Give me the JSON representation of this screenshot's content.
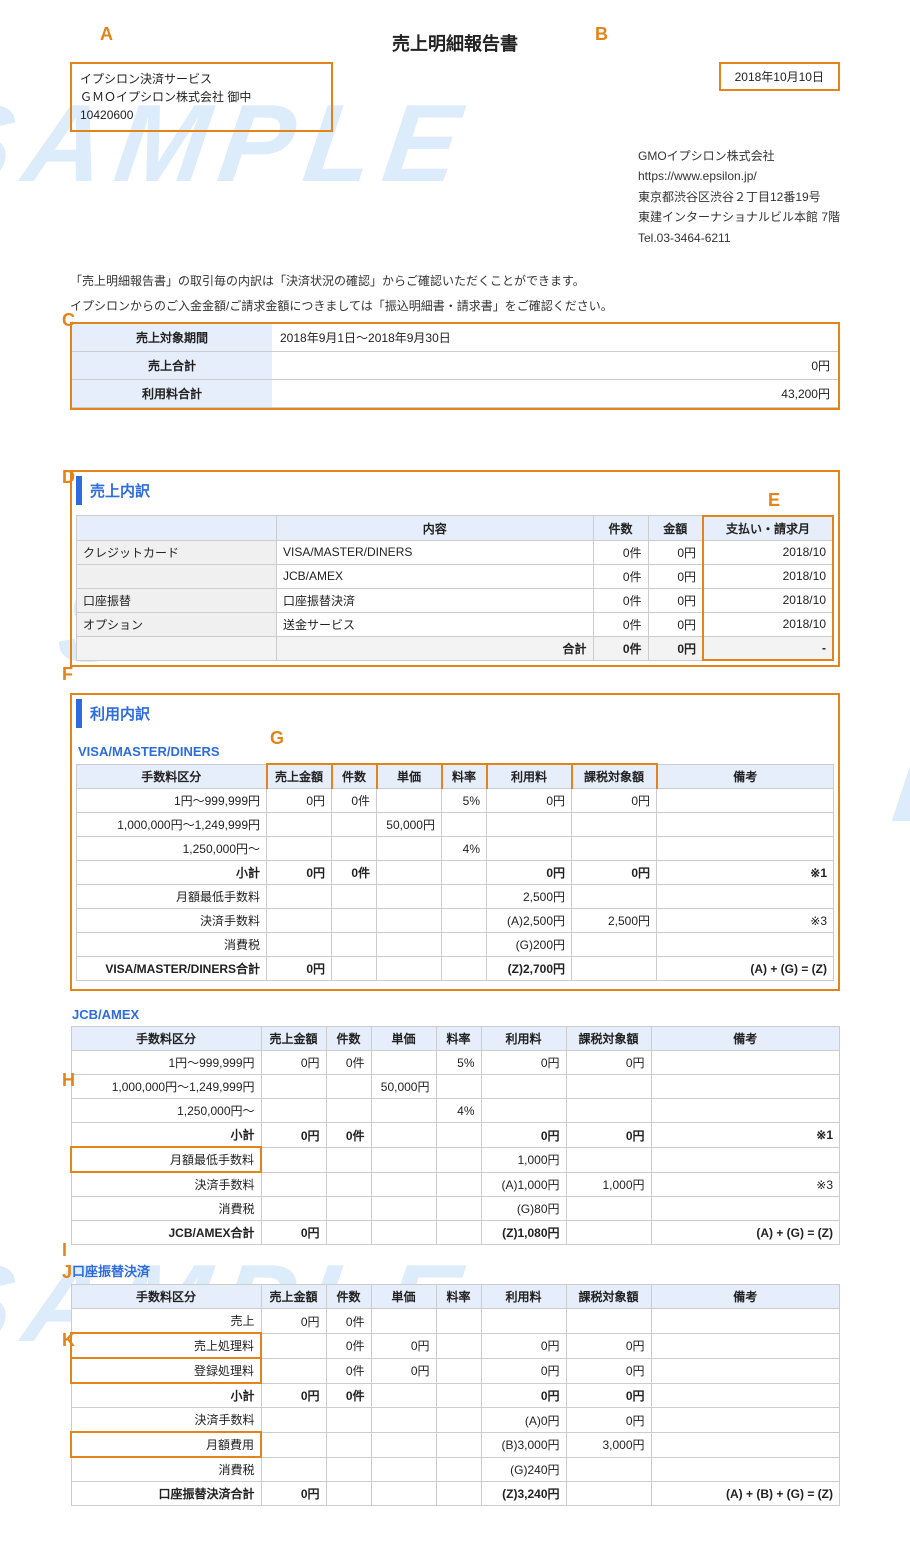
{
  "document": {
    "title": "売上明細報告書",
    "recipient": {
      "line1": "イプシロン決済サービス",
      "line2": "ＧＭＯイプシロン株式会社 御中",
      "line3": "10420600"
    },
    "issue_date": "2018年10月10日",
    "issuer": {
      "name": "GMOイプシロン株式会社",
      "url": "https://www.epsilon.jp/",
      "addr1": "東京都渋谷区渋谷２丁目12番19号",
      "addr2": "東建インターナショナルビル本館 7階",
      "tel": "Tel.03-3464-6211"
    },
    "notes": {
      "n1": "「売上明細報告書」の取引毎の内訳は「決済状況の確認」からご確認いただくことができます。",
      "n2": "イプシロンからのご入金金額/ご請求金額につきましては「振込明細書・請求書」をご確認ください。"
    },
    "summary": {
      "period_label": "売上対象期間",
      "period_value": "2018年9月1日～2018年9月30日",
      "sales_label": "売上合計",
      "sales_value": "0円",
      "fee_label": "利用料合計",
      "fee_value": "43,200円"
    }
  },
  "sales_breakdown": {
    "heading": "売上内訳",
    "cols": {
      "content": "内容",
      "count": "件数",
      "amount": "金額",
      "month": "支払い・請求月"
    },
    "rows": [
      {
        "cat": "クレジットカード",
        "content": "VISA/MASTER/DINERS",
        "count": "0件",
        "amount": "0円",
        "month": "2018/10"
      },
      {
        "cat": "",
        "content": "JCB/AMEX",
        "count": "0件",
        "amount": "0円",
        "month": "2018/10"
      },
      {
        "cat": "口座振替",
        "content": "口座振替決済",
        "count": "0件",
        "amount": "0円",
        "month": "2018/10"
      },
      {
        "cat": "オプション",
        "content": "送金サービス",
        "count": "0件",
        "amount": "0円",
        "month": "2018/10"
      }
    ],
    "total": {
      "label": "合計",
      "count": "0件",
      "amount": "0円",
      "month": "-"
    }
  },
  "usage": {
    "heading": "利用内訳",
    "cols": {
      "cat": "手数料区分",
      "sales": "売上金額",
      "count": "件数",
      "unit": "単価",
      "rate": "料率",
      "fee": "利用料",
      "tax": "課税対象額",
      "note": "備考"
    },
    "groups": [
      {
        "name": "VISA/MASTER/DINERS",
        "rows": [
          {
            "cat": "1円～999,999円",
            "sales": "0円",
            "count": "0件",
            "unit": "",
            "rate": "5%",
            "fee": "0円",
            "tax": "0円",
            "note": ""
          },
          {
            "cat": "1,000,000円～1,249,999円",
            "sales": "",
            "count": "",
            "unit": "50,000円",
            "rate": "",
            "fee": "",
            "tax": "",
            "note": ""
          },
          {
            "cat": "1,250,000円～",
            "sales": "",
            "count": "",
            "unit": "",
            "rate": "4%",
            "fee": "",
            "tax": "",
            "note": ""
          }
        ],
        "subtotal": {
          "label": "小計",
          "sales": "0円",
          "count": "0件",
          "unit": "",
          "rate": "",
          "fee": "0円",
          "tax": "0円",
          "note": "※1"
        },
        "extras": [
          {
            "label": "月額最低手数料",
            "fee": "2,500円",
            "tax": "",
            "note": ""
          },
          {
            "label": "決済手数料",
            "fee": "(A)2,500円",
            "tax": "2,500円",
            "note": "※3"
          },
          {
            "label": "消費税",
            "fee": "(G)200円",
            "tax": "",
            "note": ""
          }
        ],
        "total": {
          "label": "VISA/MASTER/DINERS合計",
          "sales": "0円",
          "fee": "(Z)2,700円",
          "formula": "(A) + (G) = (Z)"
        }
      },
      {
        "name": "JCB/AMEX",
        "rows": [
          {
            "cat": "1円～999,999円",
            "sales": "0円",
            "count": "0件",
            "unit": "",
            "rate": "5%",
            "fee": "0円",
            "tax": "0円",
            "note": ""
          },
          {
            "cat": "1,000,000円～1,249,999円",
            "sales": "",
            "count": "",
            "unit": "50,000円",
            "rate": "",
            "fee": "",
            "tax": "",
            "note": ""
          },
          {
            "cat": "1,250,000円～",
            "sales": "",
            "count": "",
            "unit": "",
            "rate": "4%",
            "fee": "",
            "tax": "",
            "note": ""
          }
        ],
        "subtotal": {
          "label": "小計",
          "sales": "0円",
          "count": "0件",
          "unit": "",
          "rate": "",
          "fee": "0円",
          "tax": "0円",
          "note": "※1"
        },
        "extras": [
          {
            "label": "月額最低手数料",
            "fee": "1,000円",
            "tax": "",
            "note": ""
          },
          {
            "label": "決済手数料",
            "fee": "(A)1,000円",
            "tax": "1,000円",
            "note": "※3"
          },
          {
            "label": "消費税",
            "fee": "(G)80円",
            "tax": "",
            "note": ""
          }
        ],
        "total": {
          "label": "JCB/AMEX合計",
          "sales": "0円",
          "fee": "(Z)1,080円",
          "formula": "(A) + (G) = (Z)"
        }
      },
      {
        "name": "口座振替決済",
        "rows": [
          {
            "cat": "売上",
            "sales": "0円",
            "count": "0件",
            "unit": "",
            "rate": "",
            "fee": "",
            "tax": "",
            "note": ""
          },
          {
            "cat": "売上処理料",
            "sales": "",
            "count": "0件",
            "unit": "0円",
            "rate": "",
            "fee": "0円",
            "tax": "0円",
            "note": ""
          },
          {
            "cat": "登録処理料",
            "sales": "",
            "count": "0件",
            "unit": "0円",
            "rate": "",
            "fee": "0円",
            "tax": "0円",
            "note": ""
          }
        ],
        "subtotal": {
          "label": "小計",
          "sales": "0円",
          "count": "0件",
          "unit": "",
          "rate": "",
          "fee": "0円",
          "tax": "0円",
          "note": ""
        },
        "extras": [
          {
            "label": "決済手数料",
            "fee": "(A)0円",
            "tax": "0円",
            "note": ""
          },
          {
            "label": "月額費用",
            "fee": "(B)3,000円",
            "tax": "3,000円",
            "note": ""
          },
          {
            "label": "消費税",
            "fee": "(G)240円",
            "tax": "",
            "note": ""
          }
        ],
        "total": {
          "label": "口座振替決済合計",
          "sales": "0円",
          "fee": "(Z)3,240円",
          "formula": "(A) + (B) + (G) = (Z)"
        }
      }
    ]
  },
  "markers": [
    "A",
    "B",
    "C",
    "D",
    "E",
    "F",
    "G",
    "H",
    "I",
    "J",
    "K"
  ]
}
